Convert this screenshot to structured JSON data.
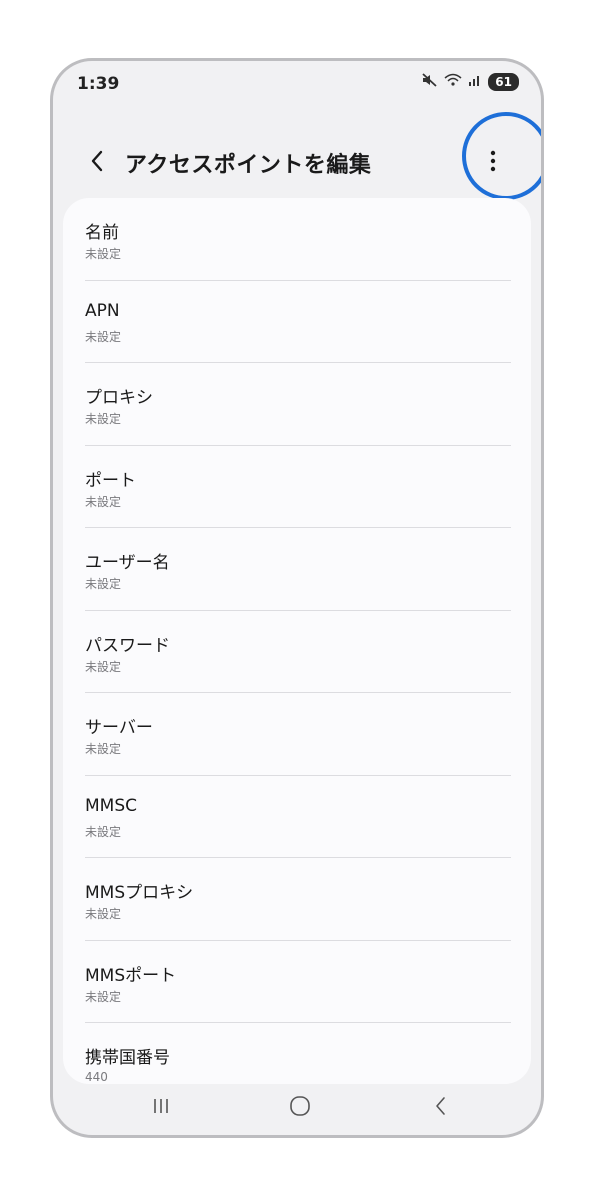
{
  "status_bar": {
    "time": "1:39",
    "battery": "61",
    "icons": [
      "mute-icon",
      "wifi-icon",
      "signal-icon",
      "battery-icon"
    ]
  },
  "header": {
    "back_icon": "back-chevron-icon",
    "title": "アクセスポイントを編集",
    "more_icon": "more-vertical-icon"
  },
  "highlight": {
    "color": "#1e6fd8",
    "target": "more-options-button"
  },
  "settings": {
    "items": [
      {
        "label": "名前",
        "value": "未設定"
      },
      {
        "label": "APN",
        "value": "未設定"
      },
      {
        "label": "プロキシ",
        "value": "未設定"
      },
      {
        "label": "ポート",
        "value": "未設定"
      },
      {
        "label": "ユーザー名",
        "value": "未設定"
      },
      {
        "label": "パスワード",
        "value": "未設定"
      },
      {
        "label": "サーバー",
        "value": "未設定"
      },
      {
        "label": "MMSC",
        "value": "未設定"
      },
      {
        "label": "MMSプロキシ",
        "value": "未設定"
      },
      {
        "label": "MMSポート",
        "value": "未設定"
      },
      {
        "label": "携帯国番号",
        "value": "440"
      }
    ]
  },
  "nav_bar": {
    "buttons": [
      "recent-apps-icon",
      "home-icon",
      "back-icon"
    ]
  }
}
